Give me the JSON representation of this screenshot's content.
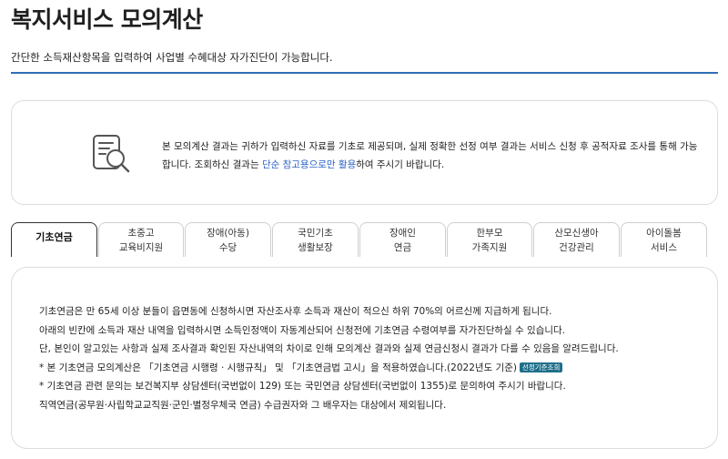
{
  "header": {
    "title": "복지서비스 모의계산",
    "description": "간단한 소득재산항목을 입력하여 사업별 수혜대상 자가진단이 가능합니다."
  },
  "notice": {
    "icon": "document-search-icon",
    "text_part1": "본 모의계산 결과는 귀하가 입력하신 자료를 기초로 제공되며, 실제 정확한 선정 여부 결과는 서비스 신청 후 공적자료 조사를 통해 가능합니다. 조회하신 결과는 ",
    "link_text": "단순 참고용으로만 활용",
    "text_part2": "하여 주시기 바랍니다."
  },
  "tabs": [
    {
      "line1": "기초연금",
      "line2": ""
    },
    {
      "line1": "초중고",
      "line2": "교육비지원"
    },
    {
      "line1": "장애(아동)",
      "line2": "수당"
    },
    {
      "line1": "국민기초",
      "line2": "생활보장"
    },
    {
      "line1": "장애인",
      "line2": "연금"
    },
    {
      "line1": "한부모",
      "line2": "가족지원"
    },
    {
      "line1": "산모신생아",
      "line2": "건강관리"
    },
    {
      "line1": "아이돌봄",
      "line2": "서비스"
    }
  ],
  "content": {
    "line1": "기초연금은 만 65세 이상 분들이 읍면동에 신청하시면 자산조사후 소득과 재산이 적으신 하위 70%의 어르신께 지급하게 됩니다.",
    "line2": "아래의 빈칸에 소득과 재산 내역을 입력하시면 소득인정액이 자동계산되어 신청전에 기초연금 수령여부를 자가진단하실 수 있습니다.",
    "line3": "단, 본인이 알고있는 사항과 실제 조사결과 확인된 자산내역의 차이로 인해 모의계산 결과와 실제 연금신청시 결과가 다를 수 있음을 알려드립니다.",
    "line4": "* 본 기초연금 모의계산은 「기초연금 시행령 · 시행규칙」 및 「기초연금법 고시」을 적용하였습니다.(2022년도 기준)",
    "badge": "선정기준조회",
    "line5": "* 기초연금 관련 문의는 보건복지부 상담센터(국번없이 129) 또는 국민연금 상담센터(국번없이 1355)로 문의하여 주시기 바랍니다.",
    "line6": "직역연금(공무원·사립학교교직원·군인·별정우체국 연금) 수급권자와 그 배우자는 대상에서 제외됩니다."
  },
  "colors": {
    "accent": "#2f6fb5",
    "link": "#2b63c6",
    "badge_bg": "#1f6f8b"
  }
}
